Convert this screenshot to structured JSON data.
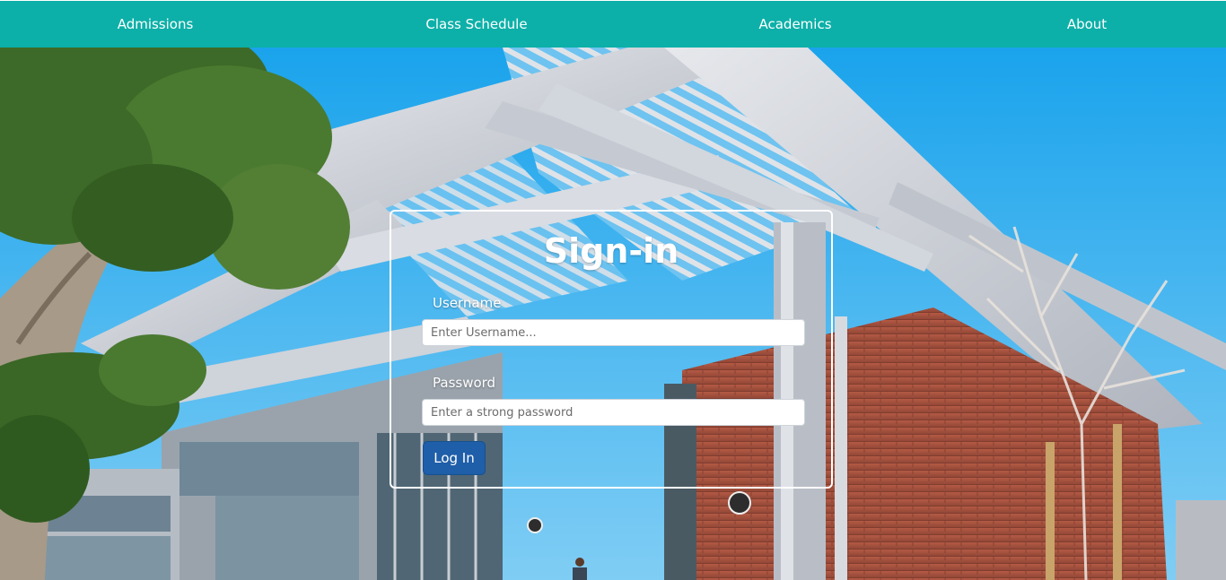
{
  "nav": {
    "items": [
      {
        "label": "Admissions"
      },
      {
        "label": "Class Schedule"
      },
      {
        "label": "Academics"
      },
      {
        "label": "About"
      }
    ],
    "background_color": "#0cb0a8"
  },
  "signin": {
    "title": "Sign-in",
    "username": {
      "label": "Username",
      "placeholder": "Enter Username..."
    },
    "password": {
      "label": "Password",
      "placeholder": "Enter a strong password"
    },
    "submit_label": "Log In",
    "button_color": "#1f5ea8"
  },
  "background": {
    "sky_color": "#2aa9ec",
    "brick_color": "#a8523f",
    "steel_color": "#c9ccd3",
    "foliage_color": "#3f6a2a"
  }
}
